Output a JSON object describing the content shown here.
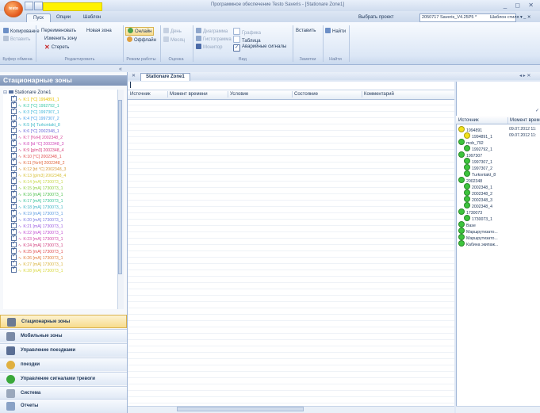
{
  "window": {
    "title": "Программное обеспечение Testo Saveris - [Stationare Zone1]",
    "controls": "_ ◻ ✕"
  },
  "app_orb_label": "testo",
  "tabs": {
    "pusk": "Пуск",
    "opcii": "Опции",
    "shablon": "Шаблон"
  },
  "project": {
    "label": "Выбрать проект",
    "value": "2050717 Saveris_V4.25P5 *",
    "style_selector": "Шаблон стиля ▾ _ ✕"
  },
  "ribbon": {
    "clipboard": {
      "copy": "Копирование",
      "paste": "Вставить",
      "label": "Буфер обмена"
    },
    "edit": {
      "rename": "Переименовать",
      "new_zone": "Новая зона",
      "change_zone": "Изменить зону",
      "delete": "Стереть",
      "label": "Редактировать"
    },
    "mode": {
      "online": "Онлайн",
      "offline": "Оффлайн",
      "label": "Режим работы"
    },
    "evaluation": {
      "day": "День",
      "month": "Месяц",
      "label": "Оценка"
    },
    "view": {
      "diagram": "Диаграмма",
      "histogram": "Гистограмма",
      "monitor": "Монитор",
      "graph": "Графика",
      "table": "Таблица",
      "alarm_signals": "Аварийные сигналы",
      "label": "Вид"
    },
    "notes": {
      "insert": "Вставить",
      "label": "Заметки"
    },
    "find": {
      "find": "Найти",
      "label": "Найти"
    }
  },
  "left_panel": {
    "header": "Стационарные зоны",
    "root": "Stationare Zone1",
    "items": [
      {
        "label": "K:1 [°C] 1994891_1",
        "color": "#e6c000"
      },
      {
        "label": "K:2 [°C] 1992792_1",
        "color": "#38c7a5"
      },
      {
        "label": "K:3 [°C] 1997307_1",
        "color": "#3fb6d9"
      },
      {
        "label": "K:4 [°C] 1997307_2",
        "color": "#4aa0e8"
      },
      {
        "label": "K:5 [n] Turkontakt_8",
        "color": "#3bb8c6"
      },
      {
        "label": "K:6 [°C] 2002348_1",
        "color": "#6a6ad8"
      },
      {
        "label": "K:7 [%rH] 2002348_2",
        "color": "#d84a9a"
      },
      {
        "label": "K:8 [td °C] 2002348_3",
        "color": "#d04ab8"
      },
      {
        "label": "K:9 [g/m3] 2002348_4",
        "color": "#d43c7a"
      },
      {
        "label": "K:10 [°C] 2002348_1",
        "color": "#e05050"
      },
      {
        "label": "K:11 [%rH] 2002348_2",
        "color": "#e0663c"
      },
      {
        "label": "K:12 [td °C] 2002348_3",
        "color": "#d89a3c"
      },
      {
        "label": "K:13 [g/m3] 2002348_4",
        "color": "#d8c23c"
      },
      {
        "label": "K:14 [mA] 1730073_1",
        "color": "#c8d84a"
      },
      {
        "label": "K:15 [mA] 1730073_1",
        "color": "#8ccc3c"
      },
      {
        "label": "K:16 [mA] 1730073_1",
        "color": "#4cc04c"
      },
      {
        "label": "K:17 [mA] 1730073_1",
        "color": "#3cc49a"
      },
      {
        "label": "K:18 [mA] 1730073_1",
        "color": "#3cb4c4"
      },
      {
        "label": "K:19 [mA] 1730073_1",
        "color": "#5a9ae0"
      },
      {
        "label": "K:20 [mA] 1730073_1",
        "color": "#7a7ae0"
      },
      {
        "label": "K:21 [mA] 1730073_1",
        "color": "#9a5ae0"
      },
      {
        "label": "K:22 [mA] 1730073_1",
        "color": "#c04ad0"
      },
      {
        "label": "K:23 [mA] 1730073_1",
        "color": "#d04aa8"
      },
      {
        "label": "K:24 [mA] 1730073_1",
        "color": "#d03c7c"
      },
      {
        "label": "K:25 [mA] 1730073_1",
        "color": "#e04c4c"
      },
      {
        "label": "K:26 [mA] 1730073_1",
        "color": "#e07c3c"
      },
      {
        "label": "K:27 [mA] 1730073_1",
        "color": "#d8b43c"
      },
      {
        "label": "K:28 [mA] 1730073_1",
        "color": "#d8d83c"
      }
    ]
  },
  "nav": {
    "stationary": "Стационарные зоны",
    "mobile": "Мобильные зоны",
    "trips_mgmt": "Управление поездками",
    "trips": "поездки",
    "alarms": "Управление сигналами тревоги",
    "system": "Система",
    "reports": "Отчеты"
  },
  "document": {
    "tab": "Stationare Zone1",
    "nav_controls": "◂ ▸ ✕"
  },
  "grid": {
    "columns": [
      "Источник",
      "Момент времени",
      "Условие",
      "Состояние",
      "Комментарий"
    ]
  },
  "right_panel": {
    "columns": [
      "Источник",
      "Момент времени"
    ],
    "rows": [
      {
        "label": "1994891",
        "status": "yellow",
        "indent": 0,
        "time": ""
      },
      {
        "label": "1994891_1",
        "status": "yellow",
        "indent": 1,
        "time": "09.07.2012 11:"
      },
      {
        "label": "mob_792",
        "status": "green",
        "indent": 0,
        "time": ""
      },
      {
        "label": "1992792_1",
        "status": "green",
        "indent": 1,
        "time": ""
      },
      {
        "label": "1997307",
        "status": "green",
        "indent": 0,
        "time": ""
      },
      {
        "label": "1997307_1",
        "status": "green",
        "indent": 1,
        "time": ""
      },
      {
        "label": "1997307_2",
        "status": "green",
        "indent": 1,
        "time": ""
      },
      {
        "label": "Turkontakt_8",
        "status": "green",
        "indent": 1,
        "time": ""
      },
      {
        "label": "2002348",
        "status": "green",
        "indent": 0,
        "time": ""
      },
      {
        "label": "2002348_1",
        "status": "green",
        "indent": 1,
        "time": ""
      },
      {
        "label": "2002348_2",
        "status": "green",
        "indent": 1,
        "time": ""
      },
      {
        "label": "2002348_3",
        "status": "green",
        "indent": 1,
        "time": ""
      },
      {
        "label": "2002348_4",
        "status": "green",
        "indent": 1,
        "time": ""
      },
      {
        "label": "1730073",
        "status": "green",
        "indent": 0,
        "time": ""
      },
      {
        "label": "1730073_1",
        "status": "green",
        "indent": 1,
        "time": ""
      },
      {
        "label": "Base",
        "status": "green",
        "indent": 0,
        "time": ""
      },
      {
        "label": "Маршрутизато...",
        "status": "green",
        "indent": 0,
        "time": ""
      },
      {
        "label": "Маршрутизато...",
        "status": "green",
        "indent": 0,
        "time": ""
      },
      {
        "label": "Кабина экипаж...",
        "status": "green",
        "indent": 0,
        "time": ""
      }
    ],
    "first_time": "09.07.2012 11:"
  },
  "colors": {
    "accent": "#f7dc8d",
    "title_highlight": "#fff200",
    "status_green": "#3cc43c",
    "status_yellow": "#f2e21c"
  }
}
